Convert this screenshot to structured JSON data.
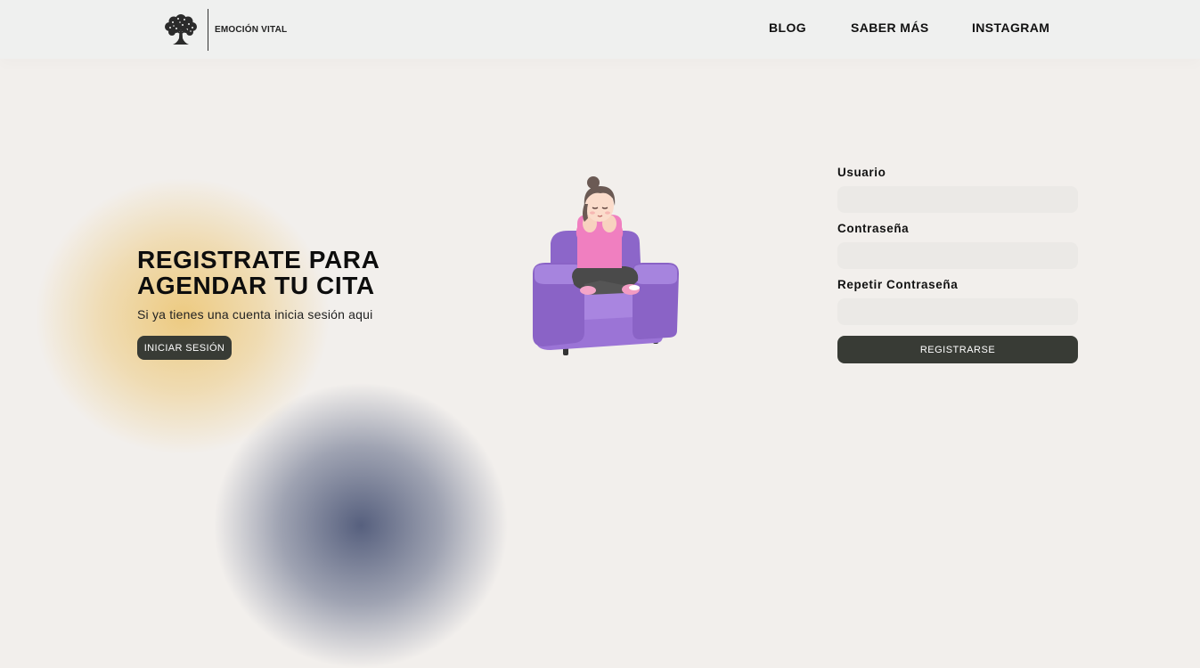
{
  "header": {
    "brand": "EMOCIÓN VITAL",
    "nav": [
      "BLOG",
      "SABER MÁS",
      "INSTAGRAM"
    ]
  },
  "hero": {
    "title_line1": "REGISTRATE PARA",
    "title_line2": "AGENDAR TU CITA",
    "subtitle": "Si ya tienes una cuenta inicia sesión aqui",
    "login_button": "INICIAR SESIÓN"
  },
  "form": {
    "username_label": "Usuario",
    "username_value": "",
    "password_label": "Contraseña",
    "password_value": "",
    "repeat_password_label": "Repetir Contraseña",
    "repeat_password_value": "",
    "submit_button": "REGISTRARSE"
  },
  "colors": {
    "background": "#f2efec",
    "header": "#eff0ef",
    "button": "#383b35",
    "field": "#ebe9e6",
    "accent_gold": "#ecc46e",
    "accent_blue": "#4e5878"
  },
  "icons": {
    "logo": "tree-icon"
  }
}
